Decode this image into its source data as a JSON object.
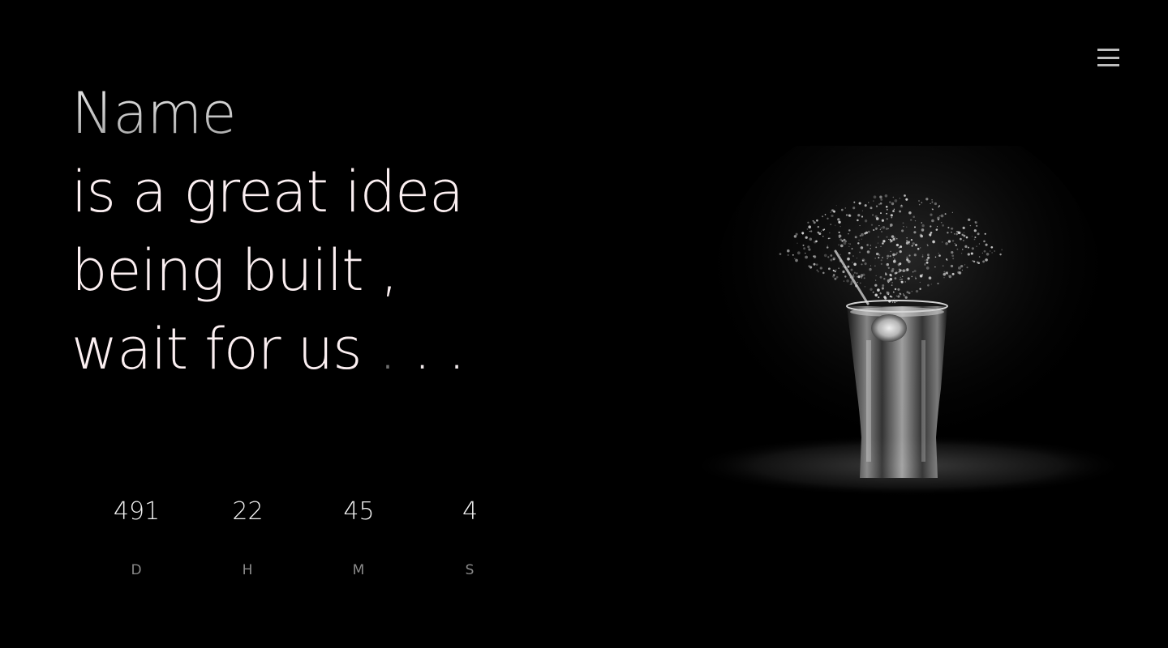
{
  "hero": {
    "name": "Name",
    "line1": "is a great idea",
    "line2": "being built ,",
    "line3": "wait for us",
    "dots": [
      ".",
      ".",
      "."
    ]
  },
  "countdown": [
    {
      "value": "491",
      "label": "D"
    },
    {
      "value": "22",
      "label": "H"
    },
    {
      "value": "45",
      "label": "M"
    },
    {
      "value": "4",
      "label": "S"
    }
  ],
  "icons": {
    "menu": "hamburger-menu-icon",
    "illustration": "splashing-glass-image"
  },
  "colors": {
    "background": "#000000",
    "headline": "#fbeff1",
    "label": "#8a8a8a",
    "menu": "#bdbdbd"
  }
}
